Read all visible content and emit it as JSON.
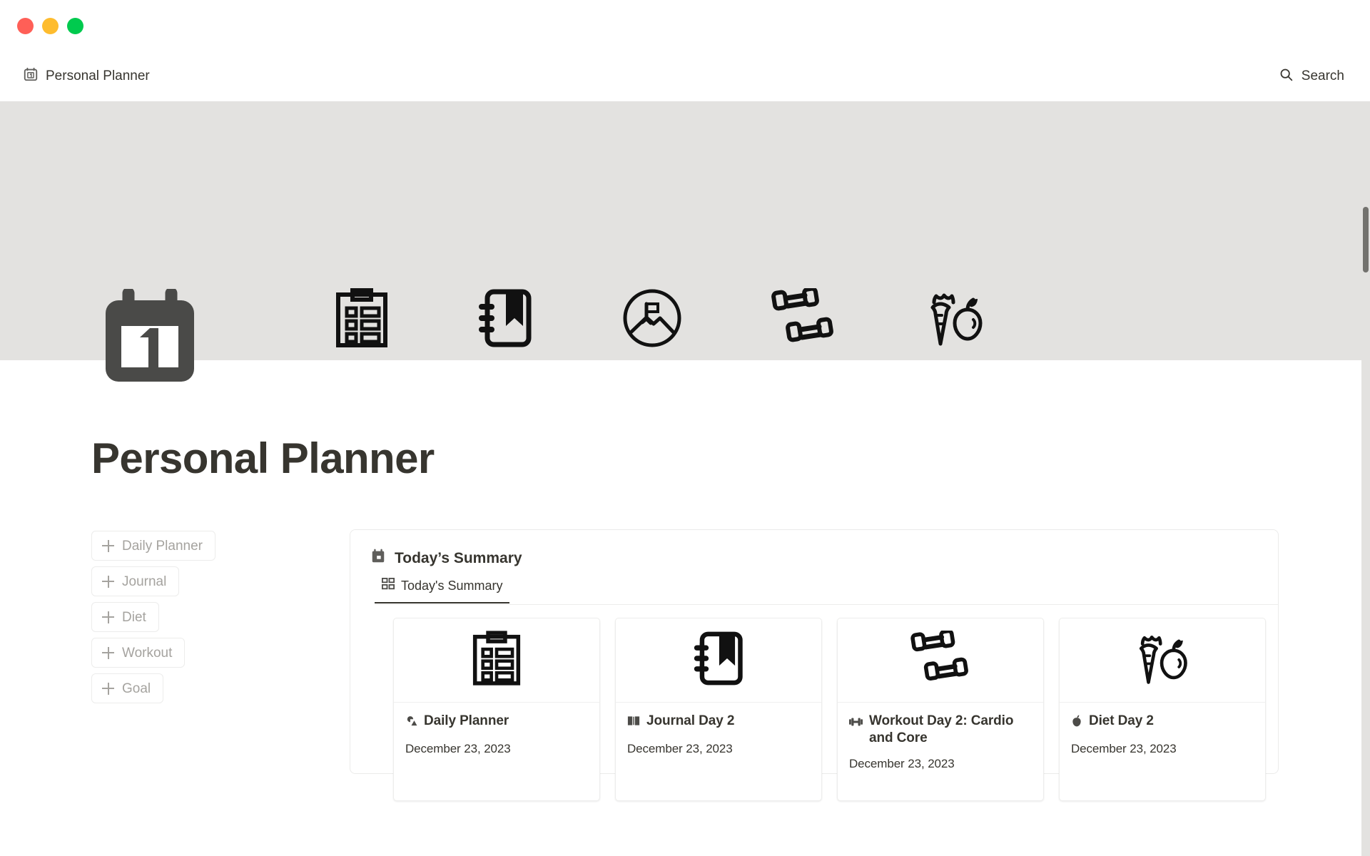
{
  "window": {
    "traffic_lights": [
      {
        "name": "close",
        "color": "#ff5f57"
      },
      {
        "name": "minimize",
        "color": "#febc2e"
      },
      {
        "name": "maximize",
        "color": "#00ca4e"
      }
    ]
  },
  "topbar": {
    "breadcrumb": "Personal Planner",
    "breadcrumb_icon": "calendar-1-icon",
    "search_label": "Search",
    "search_icon": "search-icon"
  },
  "banner": {
    "background_color": "#e3e2e0",
    "icons": [
      "clipboard-checklist-icon",
      "bookmarked-notebook-icon",
      "mountain-flag-goal-icon",
      "dumbbells-icon",
      "carrot-apple-icon"
    ]
  },
  "page": {
    "icon": "calendar-1-icon",
    "title": "Personal Planner"
  },
  "add_buttons": [
    {
      "label": "Daily Planner",
      "icon": "plus-icon"
    },
    {
      "label": "Journal",
      "icon": "plus-icon"
    },
    {
      "label": "Diet",
      "icon": "plus-icon"
    },
    {
      "label": "Workout",
      "icon": "plus-icon"
    },
    {
      "label": "Goal",
      "icon": "plus-icon"
    }
  ],
  "summary": {
    "heading": "Today’s Summary",
    "heading_icon": "calendar-icon",
    "tabs": [
      {
        "label": "Today's Summary",
        "icon": "gallery-grid-icon",
        "active": true
      }
    ],
    "cards": [
      {
        "cover_icon": "clipboard-checklist-icon",
        "title_icon": "chart-shapes-icon",
        "title": "Daily Planner",
        "date": "December 23, 2023"
      },
      {
        "cover_icon": "bookmarked-notebook-icon",
        "title_icon": "open-book-icon",
        "title": "Journal Day 2",
        "date": "December 23, 2023"
      },
      {
        "cover_icon": "dumbbells-icon",
        "title_icon": "dumbbell-icon",
        "title": "Workout Day 2: Cardio and Core",
        "date": "December 23, 2023"
      },
      {
        "cover_icon": "carrot-apple-icon",
        "title_icon": "apple-icon",
        "title": "Diet Day 2",
        "date": "December 23, 2023"
      }
    ]
  },
  "scrollbar": {
    "thumb_color": "#73726e",
    "track_color": "#e3e2e0"
  }
}
